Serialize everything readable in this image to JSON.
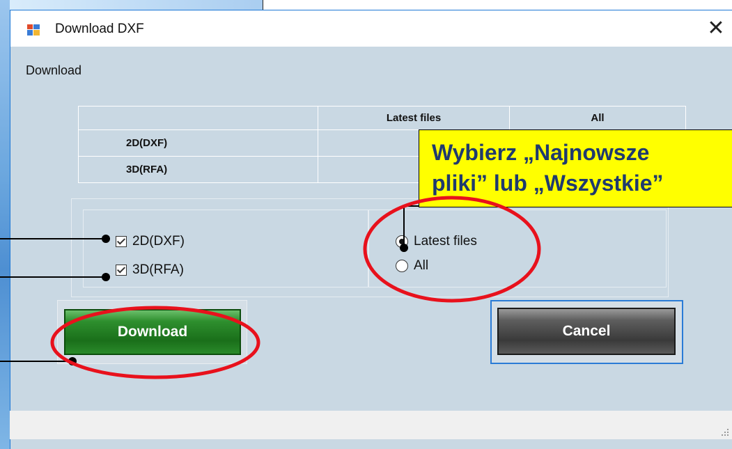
{
  "window": {
    "title": "Download DXF",
    "close_glyph": "✕"
  },
  "group": {
    "label": "Download"
  },
  "table": {
    "headers": [
      "",
      "Latest files",
      "All"
    ],
    "rows": [
      {
        "label": "2D(DXF)"
      },
      {
        "label": "3D(RFA)"
      }
    ]
  },
  "options": {
    "checkboxes": [
      {
        "label": "2D(DXF)",
        "checked": true
      },
      {
        "label": "3D(RFA)",
        "checked": true
      }
    ],
    "radios": [
      {
        "label": "Latest files",
        "selected": true
      },
      {
        "label": "All",
        "selected": false
      }
    ]
  },
  "buttons": {
    "download": "Download",
    "cancel": "Cancel"
  },
  "callout": {
    "line1": "Wybierz „Najnowsze",
    "line2": "pliki” lub „Wszystkie”"
  },
  "colors": {
    "highlight": "#e8111c",
    "callout_bg": "#ffff00",
    "callout_text": "#1f3a6e",
    "download_button": "#2e8f2e",
    "cancel_button": "#4a4a4a"
  }
}
